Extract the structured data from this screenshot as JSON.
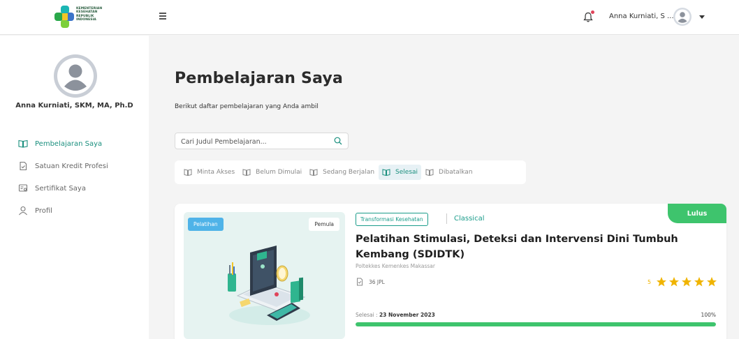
{
  "header": {
    "logo_text": [
      "KEMENTERIAN",
      "KESEHATAN",
      "REPUBLIK",
      "INDONESIA"
    ],
    "user_name": "Anna Kurniati, S ...",
    "notification_icon": "bell-icon",
    "menu_icon": "hamburger-icon"
  },
  "sidebar": {
    "user_name": "Anna Kurniati, SKM, MA, Ph.D",
    "items": [
      {
        "label": "Pembelajaran Saya",
        "icon": "book-open-icon",
        "active": true
      },
      {
        "label": "Satuan Kredit Profesi",
        "icon": "document-icon",
        "active": false
      },
      {
        "label": "Sertifikat Saya",
        "icon": "certificate-icon",
        "active": false
      },
      {
        "label": "Profil",
        "icon": "user-icon",
        "active": false
      }
    ]
  },
  "main": {
    "title": "Pembelajaran Saya",
    "subtitle": "Berikut daftar pembelajaran yang Anda ambil",
    "search": {
      "placeholder": "Cari Judul Pembelajaran..."
    },
    "tabs": [
      {
        "label": "Minta Akses",
        "active": false
      },
      {
        "label": "Belum Dimulai",
        "active": false
      },
      {
        "label": "Sedang Berjalan",
        "active": false
      },
      {
        "label": "Selesai",
        "active": true
      },
      {
        "label": "Dibatalkan",
        "active": false
      }
    ]
  },
  "course": {
    "thumb_badge_left": "Pelatihan",
    "thumb_badge_right": "Pemula",
    "category": "Transformasi Kesehatan",
    "type": "Classical",
    "status": "Lulus",
    "title": "Pelatihan Stimulasi, Deteksi dan Intervensi Dini Tumbuh Kembang (SDIDTK)",
    "provider": "Poltekkes Kemenkes Makassar",
    "jpl": "36 JPL",
    "rating": "5",
    "stars": 5,
    "completed_label": "Selesai : ",
    "completed_date": "23 November 2023",
    "progress_text": "100%",
    "progress_fraction": 1.0
  },
  "colors": {
    "accent": "#1a8f7e",
    "success": "#3ec46d",
    "star": "#f0b400",
    "badge_blue": "#4fb3e8"
  }
}
